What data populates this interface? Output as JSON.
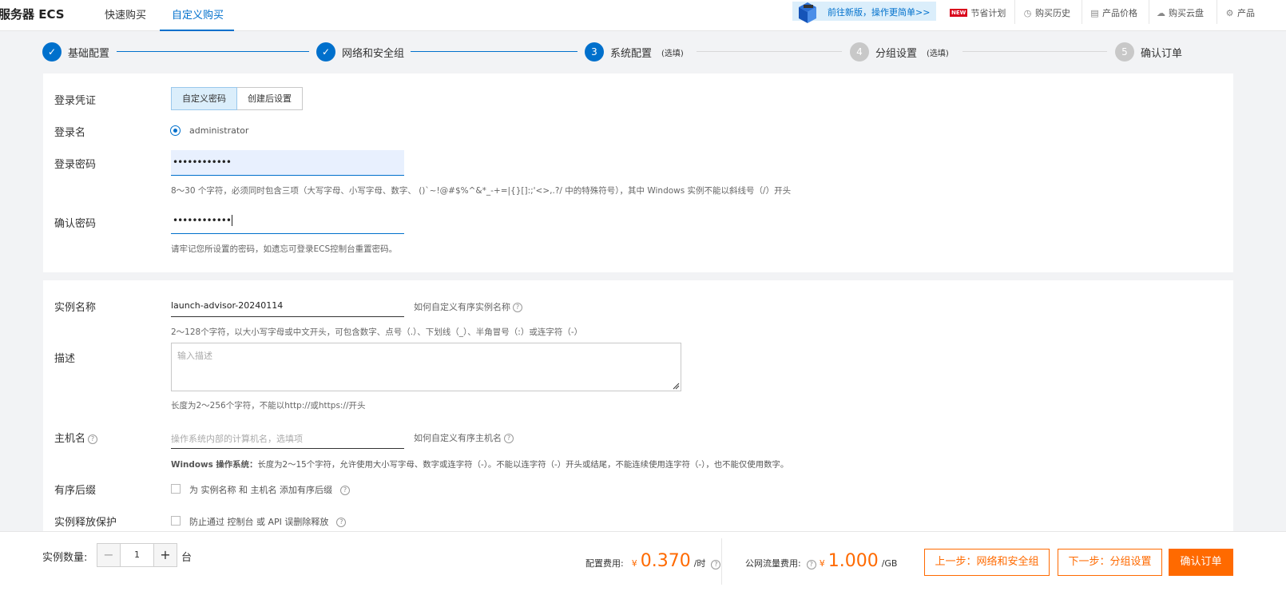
{
  "header": {
    "brand": "服务器 ECS",
    "tabs": [
      {
        "label": "快速购买",
        "active": false
      },
      {
        "label": "自定义购买",
        "active": true
      }
    ],
    "promo": "前往新版，操作更简单>>",
    "links": [
      {
        "label": "节省计划",
        "badge": "NEW"
      },
      {
        "label": "购买历史",
        "icon": "clock-icon"
      },
      {
        "label": "产品价格",
        "icon": "document-icon"
      },
      {
        "label": "购买云盘",
        "icon": "cloud-icon"
      },
      {
        "label": "产品",
        "icon": "gear-icon"
      }
    ]
  },
  "steps": [
    {
      "label": "基础配置",
      "status": "done"
    },
    {
      "label": "网络和安全组",
      "status": "done"
    },
    {
      "number": "3",
      "label": "系统配置",
      "optional": "(选填)",
      "status": "active"
    },
    {
      "number": "4",
      "label": "分组设置",
      "optional": "(选填)",
      "status": "todo"
    },
    {
      "number": "5",
      "label": "确认订单",
      "status": "todo"
    }
  ],
  "login": {
    "credential_label": "登录凭证",
    "credential_options": [
      "自定义密码",
      "创建后设置"
    ],
    "username_label": "登录名",
    "username_value": "administrator",
    "password_label": "登录密码",
    "password_value": "••••••••••••",
    "password_hint": "8～30 个字符，必须同时包含三项（大写字母、小写字母、数字、 ()`~!@#$%^&*_-+=|{}[]:;'<>,.?/ 中的特殊符号），其中 Windows 实例不能以斜线号（/）开头",
    "confirm_label": "确认密码",
    "confirm_value": "••••••••••••",
    "confirm_hint": "请牢记您所设置的密码，如遗忘可登录ECS控制台重置密码。"
  },
  "instance": {
    "name_label": "实例名称",
    "name_value": "launch-advisor-20240114",
    "name_help": "如何自定义有序实例名称",
    "name_hint": "2～128个字符，以大小写字母或中文开头，可包含数字、点号（.）、下划线（_）、半角冒号（:）或连字符（-）",
    "desc_label": "描述",
    "desc_placeholder": "输入描述",
    "desc_hint": "长度为2～256个字符，不能以http://或https://开头",
    "host_label": "主机名",
    "host_placeholder": "操作系统内部的计算机名，选填项",
    "host_help": "如何自定义有序主机名",
    "host_hint_bold": "Windows 操作系统：",
    "host_hint": "长度为2～15个字符，允许使用大小写字母、数字或连字符（-）。不能以连字符（-）开头或结尾，不能连续使用连字符（-），也不能仅使用数字。",
    "suffix_label": "有序后缀",
    "suffix_text": "为 实例名称 和 主机名 添加有序后缀",
    "protect_label": "实例释放保护",
    "protect_text": "防止通过 控制台 或 API 误删除释放"
  },
  "footer": {
    "qty_label": "实例数量:",
    "qty_value": "1",
    "qty_unit": "台",
    "config_fee_label": "配置费用:",
    "config_fee_currency": "¥",
    "config_fee": "0.370",
    "config_fee_unit": "/时",
    "traffic_fee_label": "公网流量费用:",
    "traffic_fee_currency": "¥",
    "traffic_fee": "1.000",
    "traffic_fee_unit": "/GB",
    "prev_button": "上一步：网络和安全组",
    "next_button": "下一步：分组设置",
    "confirm_button": "确认订单"
  }
}
